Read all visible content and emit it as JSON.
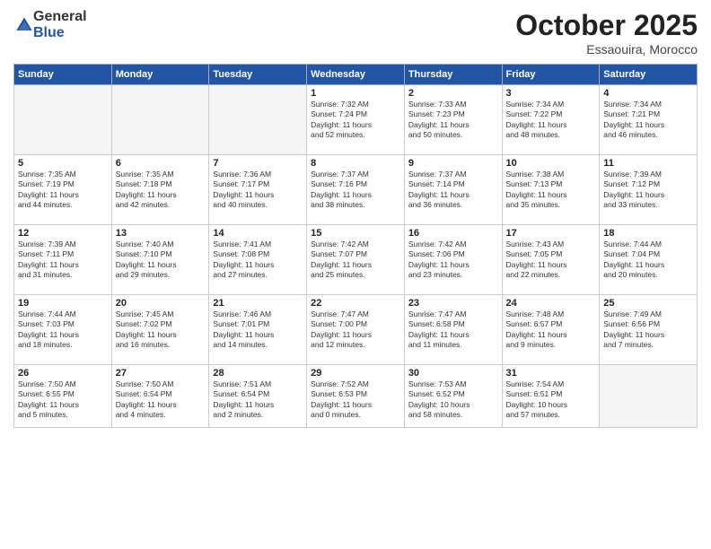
{
  "header": {
    "logo_general": "General",
    "logo_blue": "Blue",
    "month_title": "October 2025",
    "location": "Essaouira, Morocco"
  },
  "days_of_week": [
    "Sunday",
    "Monday",
    "Tuesday",
    "Wednesday",
    "Thursday",
    "Friday",
    "Saturday"
  ],
  "weeks": [
    [
      {
        "day": "",
        "info": ""
      },
      {
        "day": "",
        "info": ""
      },
      {
        "day": "",
        "info": ""
      },
      {
        "day": "1",
        "info": "Sunrise: 7:32 AM\nSunset: 7:24 PM\nDaylight: 11 hours\nand 52 minutes."
      },
      {
        "day": "2",
        "info": "Sunrise: 7:33 AM\nSunset: 7:23 PM\nDaylight: 11 hours\nand 50 minutes."
      },
      {
        "day": "3",
        "info": "Sunrise: 7:34 AM\nSunset: 7:22 PM\nDaylight: 11 hours\nand 48 minutes."
      },
      {
        "day": "4",
        "info": "Sunrise: 7:34 AM\nSunset: 7:21 PM\nDaylight: 11 hours\nand 46 minutes."
      }
    ],
    [
      {
        "day": "5",
        "info": "Sunrise: 7:35 AM\nSunset: 7:19 PM\nDaylight: 11 hours\nand 44 minutes."
      },
      {
        "day": "6",
        "info": "Sunrise: 7:35 AM\nSunset: 7:18 PM\nDaylight: 11 hours\nand 42 minutes."
      },
      {
        "day": "7",
        "info": "Sunrise: 7:36 AM\nSunset: 7:17 PM\nDaylight: 11 hours\nand 40 minutes."
      },
      {
        "day": "8",
        "info": "Sunrise: 7:37 AM\nSunset: 7:16 PM\nDaylight: 11 hours\nand 38 minutes."
      },
      {
        "day": "9",
        "info": "Sunrise: 7:37 AM\nSunset: 7:14 PM\nDaylight: 11 hours\nand 36 minutes."
      },
      {
        "day": "10",
        "info": "Sunrise: 7:38 AM\nSunset: 7:13 PM\nDaylight: 11 hours\nand 35 minutes."
      },
      {
        "day": "11",
        "info": "Sunrise: 7:39 AM\nSunset: 7:12 PM\nDaylight: 11 hours\nand 33 minutes."
      }
    ],
    [
      {
        "day": "12",
        "info": "Sunrise: 7:39 AM\nSunset: 7:11 PM\nDaylight: 11 hours\nand 31 minutes."
      },
      {
        "day": "13",
        "info": "Sunrise: 7:40 AM\nSunset: 7:10 PM\nDaylight: 11 hours\nand 29 minutes."
      },
      {
        "day": "14",
        "info": "Sunrise: 7:41 AM\nSunset: 7:08 PM\nDaylight: 11 hours\nand 27 minutes."
      },
      {
        "day": "15",
        "info": "Sunrise: 7:42 AM\nSunset: 7:07 PM\nDaylight: 11 hours\nand 25 minutes."
      },
      {
        "day": "16",
        "info": "Sunrise: 7:42 AM\nSunset: 7:06 PM\nDaylight: 11 hours\nand 23 minutes."
      },
      {
        "day": "17",
        "info": "Sunrise: 7:43 AM\nSunset: 7:05 PM\nDaylight: 11 hours\nand 22 minutes."
      },
      {
        "day": "18",
        "info": "Sunrise: 7:44 AM\nSunset: 7:04 PM\nDaylight: 11 hours\nand 20 minutes."
      }
    ],
    [
      {
        "day": "19",
        "info": "Sunrise: 7:44 AM\nSunset: 7:03 PM\nDaylight: 11 hours\nand 18 minutes."
      },
      {
        "day": "20",
        "info": "Sunrise: 7:45 AM\nSunset: 7:02 PM\nDaylight: 11 hours\nand 16 minutes."
      },
      {
        "day": "21",
        "info": "Sunrise: 7:46 AM\nSunset: 7:01 PM\nDaylight: 11 hours\nand 14 minutes."
      },
      {
        "day": "22",
        "info": "Sunrise: 7:47 AM\nSunset: 7:00 PM\nDaylight: 11 hours\nand 12 minutes."
      },
      {
        "day": "23",
        "info": "Sunrise: 7:47 AM\nSunset: 6:58 PM\nDaylight: 11 hours\nand 11 minutes."
      },
      {
        "day": "24",
        "info": "Sunrise: 7:48 AM\nSunset: 6:57 PM\nDaylight: 11 hours\nand 9 minutes."
      },
      {
        "day": "25",
        "info": "Sunrise: 7:49 AM\nSunset: 6:56 PM\nDaylight: 11 hours\nand 7 minutes."
      }
    ],
    [
      {
        "day": "26",
        "info": "Sunrise: 7:50 AM\nSunset: 6:55 PM\nDaylight: 11 hours\nand 5 minutes."
      },
      {
        "day": "27",
        "info": "Sunrise: 7:50 AM\nSunset: 6:54 PM\nDaylight: 11 hours\nand 4 minutes."
      },
      {
        "day": "28",
        "info": "Sunrise: 7:51 AM\nSunset: 6:54 PM\nDaylight: 11 hours\nand 2 minutes."
      },
      {
        "day": "29",
        "info": "Sunrise: 7:52 AM\nSunset: 6:53 PM\nDaylight: 11 hours\nand 0 minutes."
      },
      {
        "day": "30",
        "info": "Sunrise: 7:53 AM\nSunset: 6:52 PM\nDaylight: 10 hours\nand 58 minutes."
      },
      {
        "day": "31",
        "info": "Sunrise: 7:54 AM\nSunset: 6:51 PM\nDaylight: 10 hours\nand 57 minutes."
      },
      {
        "day": "",
        "info": ""
      }
    ]
  ]
}
